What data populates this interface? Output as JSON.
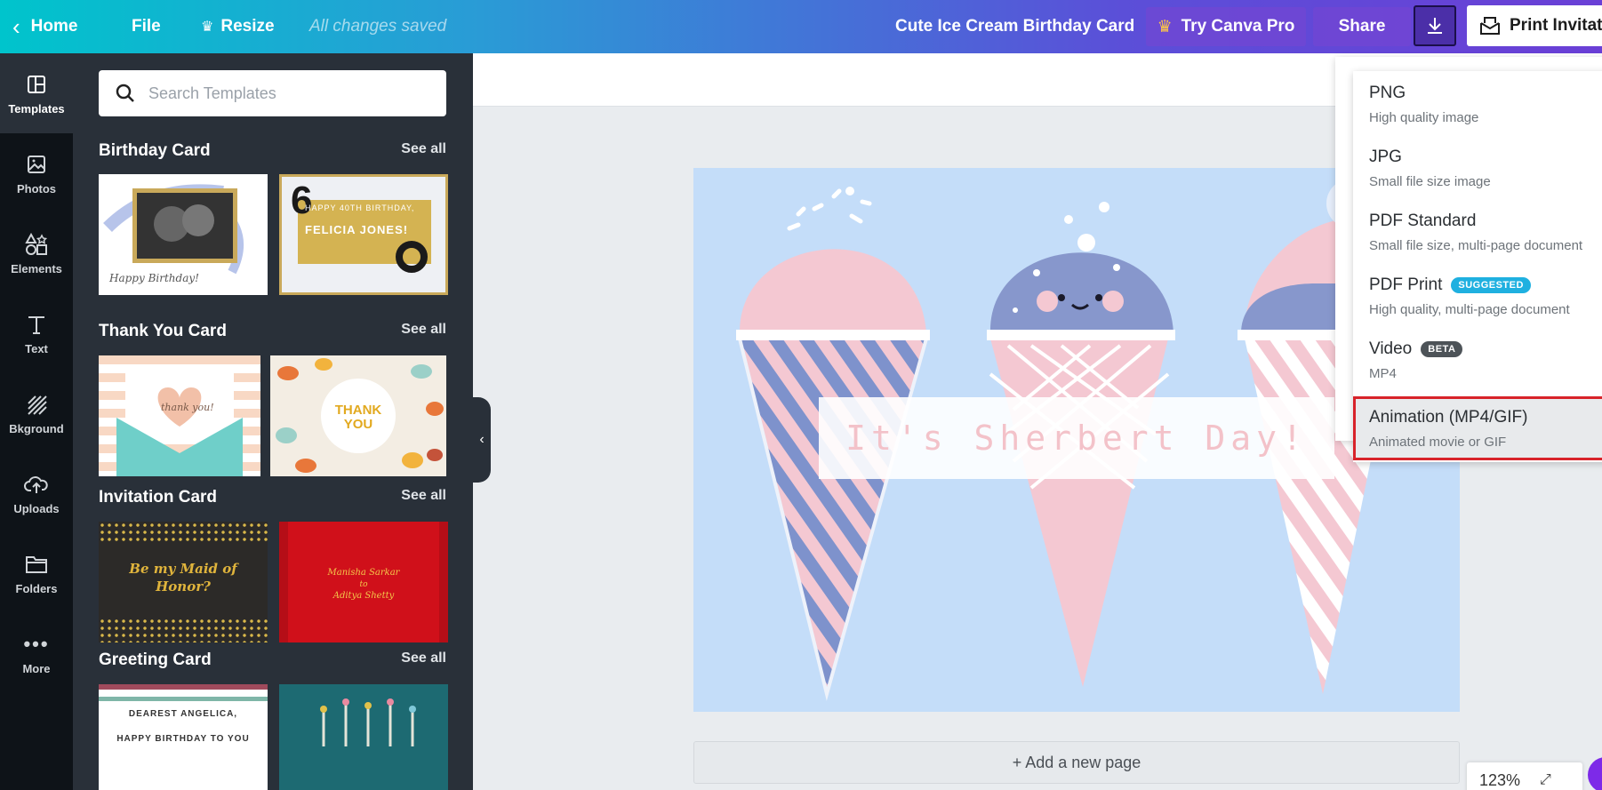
{
  "topbar": {
    "home": "Home",
    "file": "File",
    "resize": "Resize",
    "saved_status": "All changes saved",
    "doc_title": "Cute Ice Cream Birthday Card",
    "try_pro": "Try Canva Pro",
    "share": "Share",
    "print": "Print Invitati"
  },
  "rail": [
    {
      "label": "Templates",
      "icon": "templates-icon"
    },
    {
      "label": "Photos",
      "icon": "photos-icon"
    },
    {
      "label": "Elements",
      "icon": "elements-icon"
    },
    {
      "label": "Text",
      "icon": "text-icon"
    },
    {
      "label": "Bkground",
      "icon": "background-icon"
    },
    {
      "label": "Uploads",
      "icon": "uploads-icon"
    },
    {
      "label": "Folders",
      "icon": "folders-icon"
    },
    {
      "label": "More",
      "icon": "more-icon"
    }
  ],
  "panel": {
    "search_placeholder": "Search Templates",
    "see_all": "See all",
    "sections": [
      {
        "title": "Birthday Card"
      },
      {
        "title": "Thank You Card"
      },
      {
        "title": "Invitation Card"
      },
      {
        "title": "Greeting Card"
      }
    ],
    "thumbs": {
      "birthday_1": "Happy Birthday!",
      "birthday_2_line1": "HAPPY 40TH BIRTHDAY,",
      "birthday_2_name": "FELICIA JONES!",
      "birthday_2_num": "6",
      "thank_1": "thank you!",
      "thank_2": "THANK YOU",
      "invite_1_line1": "Be my Maid of",
      "invite_1_line2": "Honor?",
      "invite_2_name1": "Manisha Sarkar",
      "invite_2_to": "to",
      "invite_2_name2": "Aditya Shetty",
      "greeting_1_line1": "DEAREST ANGELICA,",
      "greeting_1_line2": "HAPPY BIRTHDAY TO YOU"
    }
  },
  "design": {
    "banner_text": "It's Sherbert Day!"
  },
  "add_page": "+ Add a new page",
  "zoom": "123%",
  "download_menu": [
    {
      "name": "PNG",
      "desc": "High quality image",
      "badge": ""
    },
    {
      "name": "JPG",
      "desc": "Small file size image",
      "badge": ""
    },
    {
      "name": "PDF Standard",
      "desc": "Small file size, multi-page document",
      "badge": ""
    },
    {
      "name": "PDF Print",
      "desc": "High quality, multi-page document",
      "badge": "SUGGESTED"
    },
    {
      "name": "Video",
      "desc": "MP4",
      "badge": "BETA"
    },
    {
      "name": "Animation (MP4/GIF)",
      "desc": "Animated movie or GIF",
      "badge": ""
    }
  ],
  "colors": {
    "canvas_bg": "#c4ddf9",
    "pink": "#f4c8d2",
    "periwinkle": "#7e92cc",
    "selected_border": "#d8232a"
  }
}
